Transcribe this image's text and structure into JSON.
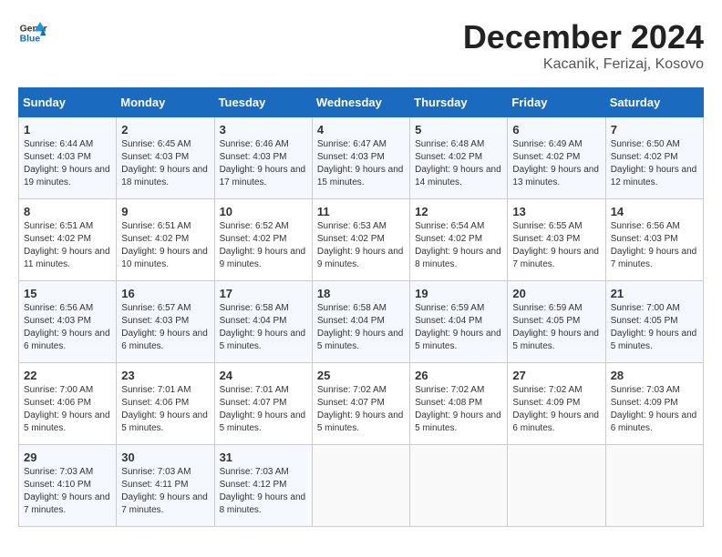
{
  "logo": {
    "line1": "General",
    "line2": "Blue"
  },
  "title": "December 2024",
  "subtitle": "Kacanik, Ferizaj, Kosovo",
  "headers": [
    "Sunday",
    "Monday",
    "Tuesday",
    "Wednesday",
    "Thursday",
    "Friday",
    "Saturday"
  ],
  "weeks": [
    [
      {
        "day": "1",
        "sunrise": "6:44 AM",
        "sunset": "4:03 PM",
        "daylight": "9 hours and 19 minutes."
      },
      {
        "day": "2",
        "sunrise": "6:45 AM",
        "sunset": "4:03 PM",
        "daylight": "9 hours and 18 minutes."
      },
      {
        "day": "3",
        "sunrise": "6:46 AM",
        "sunset": "4:03 PM",
        "daylight": "9 hours and 17 minutes."
      },
      {
        "day": "4",
        "sunrise": "6:47 AM",
        "sunset": "4:03 PM",
        "daylight": "9 hours and 15 minutes."
      },
      {
        "day": "5",
        "sunrise": "6:48 AM",
        "sunset": "4:02 PM",
        "daylight": "9 hours and 14 minutes."
      },
      {
        "day": "6",
        "sunrise": "6:49 AM",
        "sunset": "4:02 PM",
        "daylight": "9 hours and 13 minutes."
      },
      {
        "day": "7",
        "sunrise": "6:50 AM",
        "sunset": "4:02 PM",
        "daylight": "9 hours and 12 minutes."
      }
    ],
    [
      {
        "day": "8",
        "sunrise": "6:51 AM",
        "sunset": "4:02 PM",
        "daylight": "9 hours and 11 minutes."
      },
      {
        "day": "9",
        "sunrise": "6:51 AM",
        "sunset": "4:02 PM",
        "daylight": "9 hours and 10 minutes."
      },
      {
        "day": "10",
        "sunrise": "6:52 AM",
        "sunset": "4:02 PM",
        "daylight": "9 hours and 9 minutes."
      },
      {
        "day": "11",
        "sunrise": "6:53 AM",
        "sunset": "4:02 PM",
        "daylight": "9 hours and 9 minutes."
      },
      {
        "day": "12",
        "sunrise": "6:54 AM",
        "sunset": "4:02 PM",
        "daylight": "9 hours and 8 minutes."
      },
      {
        "day": "13",
        "sunrise": "6:55 AM",
        "sunset": "4:03 PM",
        "daylight": "9 hours and 7 minutes."
      },
      {
        "day": "14",
        "sunrise": "6:56 AM",
        "sunset": "4:03 PM",
        "daylight": "9 hours and 7 minutes."
      }
    ],
    [
      {
        "day": "15",
        "sunrise": "6:56 AM",
        "sunset": "4:03 PM",
        "daylight": "9 hours and 6 minutes."
      },
      {
        "day": "16",
        "sunrise": "6:57 AM",
        "sunset": "4:03 PM",
        "daylight": "9 hours and 6 minutes."
      },
      {
        "day": "17",
        "sunrise": "6:58 AM",
        "sunset": "4:04 PM",
        "daylight": "9 hours and 5 minutes."
      },
      {
        "day": "18",
        "sunrise": "6:58 AM",
        "sunset": "4:04 PM",
        "daylight": "9 hours and 5 minutes."
      },
      {
        "day": "19",
        "sunrise": "6:59 AM",
        "sunset": "4:04 PM",
        "daylight": "9 hours and 5 minutes."
      },
      {
        "day": "20",
        "sunrise": "6:59 AM",
        "sunset": "4:05 PM",
        "daylight": "9 hours and 5 minutes."
      },
      {
        "day": "21",
        "sunrise": "7:00 AM",
        "sunset": "4:05 PM",
        "daylight": "9 hours and 5 minutes."
      }
    ],
    [
      {
        "day": "22",
        "sunrise": "7:00 AM",
        "sunset": "4:06 PM",
        "daylight": "9 hours and 5 minutes."
      },
      {
        "day": "23",
        "sunrise": "7:01 AM",
        "sunset": "4:06 PM",
        "daylight": "9 hours and 5 minutes."
      },
      {
        "day": "24",
        "sunrise": "7:01 AM",
        "sunset": "4:07 PM",
        "daylight": "9 hours and 5 minutes."
      },
      {
        "day": "25",
        "sunrise": "7:02 AM",
        "sunset": "4:07 PM",
        "daylight": "9 hours and 5 minutes."
      },
      {
        "day": "26",
        "sunrise": "7:02 AM",
        "sunset": "4:08 PM",
        "daylight": "9 hours and 5 minutes."
      },
      {
        "day": "27",
        "sunrise": "7:02 AM",
        "sunset": "4:09 PM",
        "daylight": "9 hours and 6 minutes."
      },
      {
        "day": "28",
        "sunrise": "7:03 AM",
        "sunset": "4:09 PM",
        "daylight": "9 hours and 6 minutes."
      }
    ],
    [
      {
        "day": "29",
        "sunrise": "7:03 AM",
        "sunset": "4:10 PM",
        "daylight": "9 hours and 7 minutes."
      },
      {
        "day": "30",
        "sunrise": "7:03 AM",
        "sunset": "4:11 PM",
        "daylight": "9 hours and 7 minutes."
      },
      {
        "day": "31",
        "sunrise": "7:03 AM",
        "sunset": "4:12 PM",
        "daylight": "9 hours and 8 minutes."
      },
      null,
      null,
      null,
      null
    ]
  ]
}
